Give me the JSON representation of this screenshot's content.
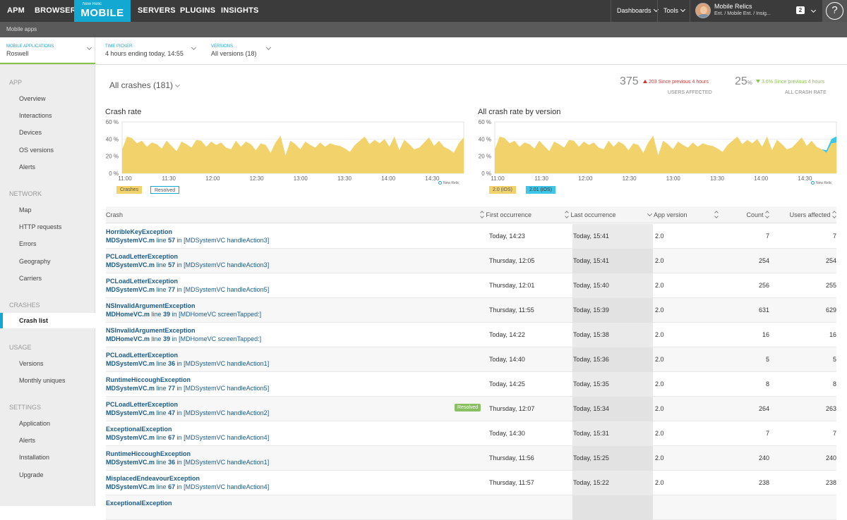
{
  "nav": {
    "items": [
      "APM",
      "BROWSER",
      "SERVERS",
      "PLUGINS",
      "INSIGHTS"
    ],
    "logo_small": "New Relic",
    "logo_main": "MOBILE",
    "dashboards": "Dashboards",
    "tools": "Tools",
    "user_name": "Mobile Relics",
    "user_account": "Ent. / Mobile Ent. / Insig...",
    "badge_count": "2",
    "help_icon": "?"
  },
  "subbar": {
    "label": "Mobile apps"
  },
  "pickers": {
    "app": {
      "label": "MOBILE APPLICATIONS",
      "value": "Roswell"
    },
    "time": {
      "label": "TIME PICKER",
      "value": "4 hours ending today, 14:55"
    },
    "versions": {
      "label": "VERSIONS",
      "value": "All versions (18)"
    }
  },
  "sidebar": {
    "app_head": "APP",
    "app_items": [
      "Overview",
      "Interactions",
      "Devices",
      "OS versions",
      "Alerts"
    ],
    "network_head": "NETWORK",
    "network_items": [
      "Map",
      "HTTP requests",
      "Errors",
      "Geography",
      "Carriers"
    ],
    "crashes_head": "CRASHES",
    "crashes_items": [
      "Crash list"
    ],
    "usage_head": "USAGE",
    "usage_items": [
      "Versions",
      "Monthly uniques"
    ],
    "settings_head": "SETTINGS",
    "settings_items": [
      "Application",
      "Alerts",
      "Installation",
      "Upgrade"
    ]
  },
  "summary": {
    "crash_select": "All crashes (181)",
    "users_affected": {
      "value": "375",
      "delta": "203 Since previous 4 hours",
      "label": "USERS AFFECTED"
    },
    "crash_rate": {
      "value": "25",
      "unit": "%",
      "delta": "3.6% Since previous 4 hours",
      "label": "ALL CRASH RATE"
    }
  },
  "colors": {
    "accent": "#13a8d2",
    "crashes": "#f2d26a",
    "resolved_badge": "#8bbf64",
    "link": "#1a5b8a",
    "up": "#d32f2f",
    "down": "#8bc34a"
  },
  "chart_data": [
    {
      "type": "area",
      "title": "Crash rate",
      "y_ticks": [
        "60 %",
        "40 %",
        "20 %",
        "0 %"
      ],
      "x_ticks": [
        "11:00",
        "11:30",
        "12:00",
        "12:30",
        "13:00",
        "13:30",
        "14:00",
        "14:30"
      ],
      "ylim": [
        0,
        60
      ],
      "series": [
        {
          "name": "Crashes",
          "values": [
            28,
            43,
            41,
            35,
            38,
            31,
            36,
            34,
            29,
            38,
            32,
            26,
            37,
            34,
            30,
            39,
            38,
            31,
            37,
            33,
            36,
            30,
            28,
            38,
            31,
            37,
            34,
            27,
            35,
            33,
            24,
            36,
            44,
            21,
            38,
            34,
            28,
            37,
            33,
            30,
            36,
            31,
            35,
            33,
            32,
            29,
            25,
            33,
            38,
            43,
            34,
            39,
            35,
            40,
            31,
            43,
            27,
            39,
            34,
            28,
            30,
            36,
            42,
            32,
            38,
            31,
            28,
            24,
            35,
            42
          ]
        },
        {
          "name": "Resolved",
          "values": []
        }
      ],
      "legend": [
        "Crashes",
        "Resolved"
      ],
      "watermark": "New Relic"
    },
    {
      "type": "area",
      "title": "All crash rate by version",
      "y_ticks": [
        "60 %",
        "40 %",
        "20 %",
        "0 %"
      ],
      "x_ticks": [
        "11:00",
        "11:30",
        "12:00",
        "12:30",
        "13:00",
        "13:30",
        "14:00",
        "14:30"
      ],
      "ylim": [
        0,
        60
      ],
      "series": [
        {
          "name": "2.0 (iOS)",
          "values": [
            28,
            43,
            41,
            35,
            38,
            31,
            36,
            34,
            29,
            38,
            32,
            26,
            37,
            34,
            30,
            39,
            38,
            31,
            37,
            33,
            36,
            30,
            28,
            38,
            31,
            37,
            34,
            27,
            35,
            33,
            24,
            36,
            44,
            21,
            38,
            34,
            28,
            37,
            33,
            30,
            36,
            31,
            35,
            33,
            32,
            29,
            25,
            33,
            38,
            43,
            34,
            39,
            35,
            40,
            31,
            43,
            27,
            39,
            34,
            28,
            30,
            36,
            42,
            32,
            38,
            31,
            28,
            24,
            35,
            36
          ]
        },
        {
          "name": "2.01 (iOS)",
          "values": [
            0,
            0,
            0,
            0,
            0,
            0,
            0,
            0,
            0,
            0,
            0,
            0,
            0,
            0,
            0,
            0,
            0,
            0,
            0,
            0,
            0,
            0,
            0,
            0,
            0,
            0,
            0,
            0,
            0,
            0,
            0,
            0,
            0,
            0,
            0,
            0,
            0,
            0,
            0,
            0,
            0,
            0,
            0,
            0,
            0,
            0,
            0,
            0,
            0,
            0,
            0,
            0,
            0,
            0,
            0,
            0,
            0,
            0,
            0,
            0,
            0,
            0,
            0,
            0,
            0,
            0,
            0,
            3,
            5,
            7
          ]
        }
      ],
      "legend": [
        "2.0 (iOS)",
        "2.01 (iOS)"
      ],
      "watermark": "New Relic"
    }
  ],
  "table": {
    "headers": {
      "crash": "Crash",
      "first": "First occurrence",
      "last": "Last occurrence",
      "version": "App version",
      "count": "Count",
      "users": "Users affected"
    },
    "resolved_label": "Resolved",
    "rows": [
      {
        "exception": "HorribleKeyException",
        "file": "MDSystemVC.m",
        "line_word": "line",
        "line": "57",
        "in_word": "in",
        "method": "[MDSystemVC handleAction3]",
        "first": "Today, 14:23",
        "last": "Today, 15:41",
        "version": "2.0",
        "count": "7",
        "users": "7"
      },
      {
        "exception": "PCLoadLetterException",
        "file": "MDSystemVC.m",
        "line_word": "line",
        "line": "57",
        "in_word": "in",
        "method": "[MDSystemVC handleAction3]",
        "first": "Thursday, 12:05",
        "last": "Today, 15:41",
        "version": "2.0",
        "count": "254",
        "users": "254"
      },
      {
        "exception": "PCLoadLetterException",
        "file": "MDSystemVC.m",
        "line_word": "line",
        "line": "77",
        "in_word": "in",
        "method": "[MDSystemVC handleAction5]",
        "first": "Thursday, 12:01",
        "last": "Today, 15:40",
        "version": "2.0",
        "count": "256",
        "users": "255"
      },
      {
        "exception": "NSInvalidArgumentException",
        "file": "MDHomeVC.m",
        "line_word": "line",
        "line": "39",
        "in_word": "in",
        "method": "[MDHomeVC screenTapped:]",
        "first": "Thursday, 11:55",
        "last": "Today, 15:39",
        "version": "2.0",
        "count": "631",
        "users": "629"
      },
      {
        "exception": "NSInvalidArgumentException",
        "file": "MDHomeVC.m",
        "line_word": "line",
        "line": "39",
        "in_word": "in",
        "method": "[MDHomeVC screenTapped:]",
        "first": "Today, 14:22",
        "last": "Today, 15:38",
        "version": "2.0",
        "count": "16",
        "users": "16"
      },
      {
        "exception": "PCLoadLetterException",
        "file": "MDSystemVC.m",
        "line_word": "line",
        "line": "36",
        "in_word": "in",
        "method": "[MDSystemVC handleAction1]",
        "first": "Today, 14:40",
        "last": "Today, 15:36",
        "version": "2.0",
        "count": "5",
        "users": "5"
      },
      {
        "exception": "RuntimeHiccoughException",
        "file": "MDSystemVC.m",
        "line_word": "line",
        "line": "77",
        "in_word": "in",
        "method": "[MDSystemVC handleAction5]",
        "first": "Today, 14:25",
        "last": "Today, 15:35",
        "version": "2.0",
        "count": "8",
        "users": "8"
      },
      {
        "exception": "PCLoadLetterException",
        "file": "MDSystemVC.m",
        "line_word": "line",
        "line": "47",
        "in_word": "in",
        "method": "[MDSystemVC handleAction2]",
        "first": "Thursday, 12:07",
        "last": "Today, 15:34",
        "version": "2.0",
        "count": "264",
        "users": "263",
        "resolved": true
      },
      {
        "exception": "ExceptionalException",
        "file": "MDSystemVC.m",
        "line_word": "line",
        "line": "67",
        "in_word": "in",
        "method": "[MDSystemVC handleAction4]",
        "first": "Today, 14:30",
        "last": "Today, 15:31",
        "version": "2.0",
        "count": "7",
        "users": "7"
      },
      {
        "exception": "RuntimeHiccoughException",
        "file": "MDSystemVC.m",
        "line_word": "line",
        "line": "36",
        "in_word": "in",
        "method": "[MDSystemVC handleAction1]",
        "first": "Thursday, 11:56",
        "last": "Today, 15:25",
        "version": "2.0",
        "count": "240",
        "users": "240"
      },
      {
        "exception": "MisplacedEndeavourException",
        "file": "MDSystemVC.m",
        "line_word": "line",
        "line": "67",
        "in_word": "in",
        "method": "[MDSystemVC handleAction4]",
        "first": "Thursday, 11:57",
        "last": "Today, 15:22",
        "version": "2.0",
        "count": "238",
        "users": "238"
      },
      {
        "exception": "ExceptionalException",
        "file": "",
        "line_word": "",
        "line": "",
        "in_word": "",
        "method": "",
        "first": "",
        "last": "",
        "version": "",
        "count": "",
        "users": ""
      }
    ]
  }
}
